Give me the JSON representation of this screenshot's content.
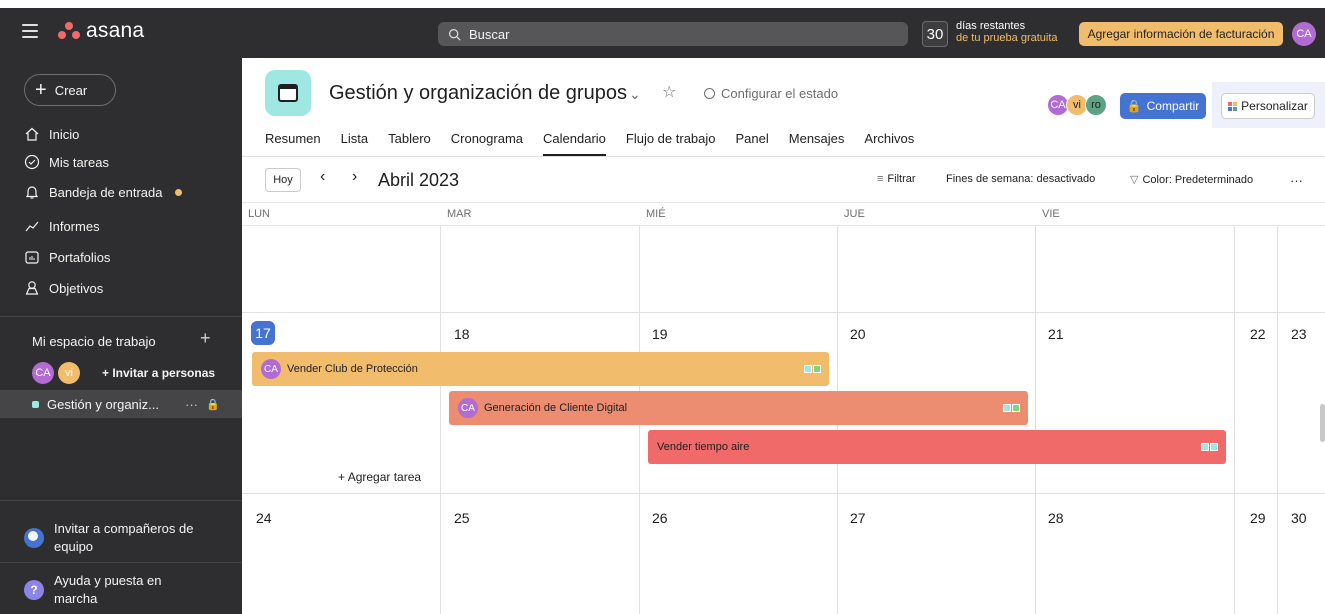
{
  "topbar": {
    "logo_text": "asana",
    "search_placeholder": "Buscar",
    "trial_days": "30",
    "trial_line1": "días restantes",
    "trial_line2": "de tu prueba gratuita",
    "billing_label": "Agregar información de facturación",
    "user_initials": "CA"
  },
  "sidebar": {
    "create_label": "Crear",
    "nav": [
      {
        "label": "Inicio",
        "icon": "home-icon"
      },
      {
        "label": "Mis tareas",
        "icon": "check-circle-icon"
      },
      {
        "label": "Bandeja de entrada",
        "icon": "bell-icon"
      },
      {
        "label": "Informes",
        "icon": "chart-line-icon"
      },
      {
        "label": "Portafolios",
        "icon": "folder-icon"
      },
      {
        "label": "Objetivos",
        "icon": "person-icon"
      }
    ],
    "workspace_title": "Mi espacio de trabajo",
    "workspace_add": "+",
    "members": [
      "CA",
      "vi"
    ],
    "invite_label": "Invitar a personas",
    "project_label": "Gestión y organiz...",
    "project_more": "···",
    "invite_team_line1": "Invitar a compañeros de",
    "invite_team_line2": "equipo",
    "help_line1": "Ayuda y puesta en",
    "help_line2": "marcha",
    "help_icon_char": "?"
  },
  "header": {
    "project_title": "Gestión y organización de grupos",
    "status_label": "Configurar el estado",
    "members": [
      "CA",
      "vi",
      "ro"
    ],
    "share_label": "Compartir",
    "customize_label": "Personalizar"
  },
  "tabs": [
    "Resumen",
    "Lista",
    "Tablero",
    "Cronograma",
    "Calendario",
    "Flujo de trabajo",
    "Panel",
    "Mensajes",
    "Archivos"
  ],
  "toolbar": {
    "today_label": "Hoy",
    "month_label": "Abril 2023",
    "filter_label": "Filtrar",
    "weekends_label": "Fines de semana: desactivado",
    "color_label": "Color: Predeterminado",
    "more_label": "···"
  },
  "calendar": {
    "day_headers": [
      "LUN",
      "MAR",
      "MIÉ",
      "JUE",
      "VIE"
    ],
    "week2": [
      "17",
      "18",
      "19",
      "20",
      "21",
      "22",
      "23"
    ],
    "week3": [
      "24",
      "25",
      "26",
      "27",
      "28",
      "29",
      "30"
    ],
    "add_task_label": "Agregar tarea",
    "tasks": [
      {
        "name": "Vender Club de Protección",
        "assignee": "CA",
        "color": "#f1bd6c"
      },
      {
        "name": "Generación de Cliente Digital",
        "assignee": "CA",
        "color": "#ec8d71"
      },
      {
        "name": "Vender tiempo aire",
        "assignee": "",
        "color": "#f06a6a"
      }
    ]
  },
  "colors": {
    "sidebar_bg": "#2e2e30",
    "accent_blue": "#4573d2",
    "avatar_purple": "#b36bd4",
    "avatar_yellow": "#f1bd6c",
    "avatar_teal": "#9ee7e3"
  }
}
